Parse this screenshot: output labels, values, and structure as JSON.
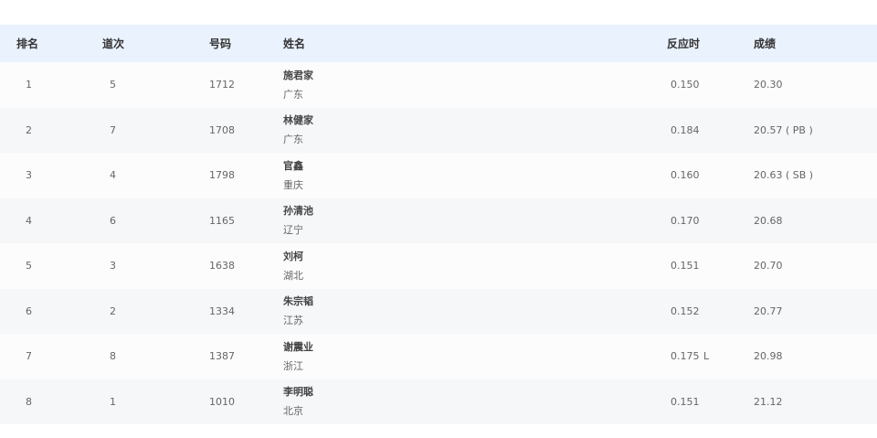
{
  "table": {
    "headers": {
      "rank": "排名",
      "lane": "道次",
      "bib": "号码",
      "name": "姓名",
      "reaction": "反应时",
      "result": "成绩"
    },
    "rows": [
      {
        "rank": "1",
        "lane": "5",
        "bib": "1712",
        "name": "施君家",
        "province": "广东",
        "reaction": "0.150",
        "flag": "",
        "result": "20.30"
      },
      {
        "rank": "2",
        "lane": "7",
        "bib": "1708",
        "name": "林健家",
        "province": "广东",
        "reaction": "0.184",
        "flag": "",
        "result": "20.57 ( PB )"
      },
      {
        "rank": "3",
        "lane": "4",
        "bib": "1798",
        "name": "官鑫",
        "province": "重庆",
        "reaction": "0.160",
        "flag": "",
        "result": "20.63 ( SB )"
      },
      {
        "rank": "4",
        "lane": "6",
        "bib": "1165",
        "name": "孙清池",
        "province": "辽宁",
        "reaction": "0.170",
        "flag": "",
        "result": "20.68"
      },
      {
        "rank": "5",
        "lane": "3",
        "bib": "1638",
        "name": "刘柯",
        "province": "湖北",
        "reaction": "0.151",
        "flag": "",
        "result": "20.70"
      },
      {
        "rank": "6",
        "lane": "2",
        "bib": "1334",
        "name": "朱宗韬",
        "province": "江苏",
        "reaction": "0.152",
        "flag": "",
        "result": "20.77"
      },
      {
        "rank": "7",
        "lane": "8",
        "bib": "1387",
        "name": "谢震业",
        "province": "浙江",
        "reaction": "0.175",
        "flag": "L",
        "result": "20.98"
      },
      {
        "rank": "8",
        "lane": "1",
        "bib": "1010",
        "name": "李明聪",
        "province": "北京",
        "reaction": "0.151",
        "flag": "",
        "result": "21.12"
      }
    ]
  }
}
